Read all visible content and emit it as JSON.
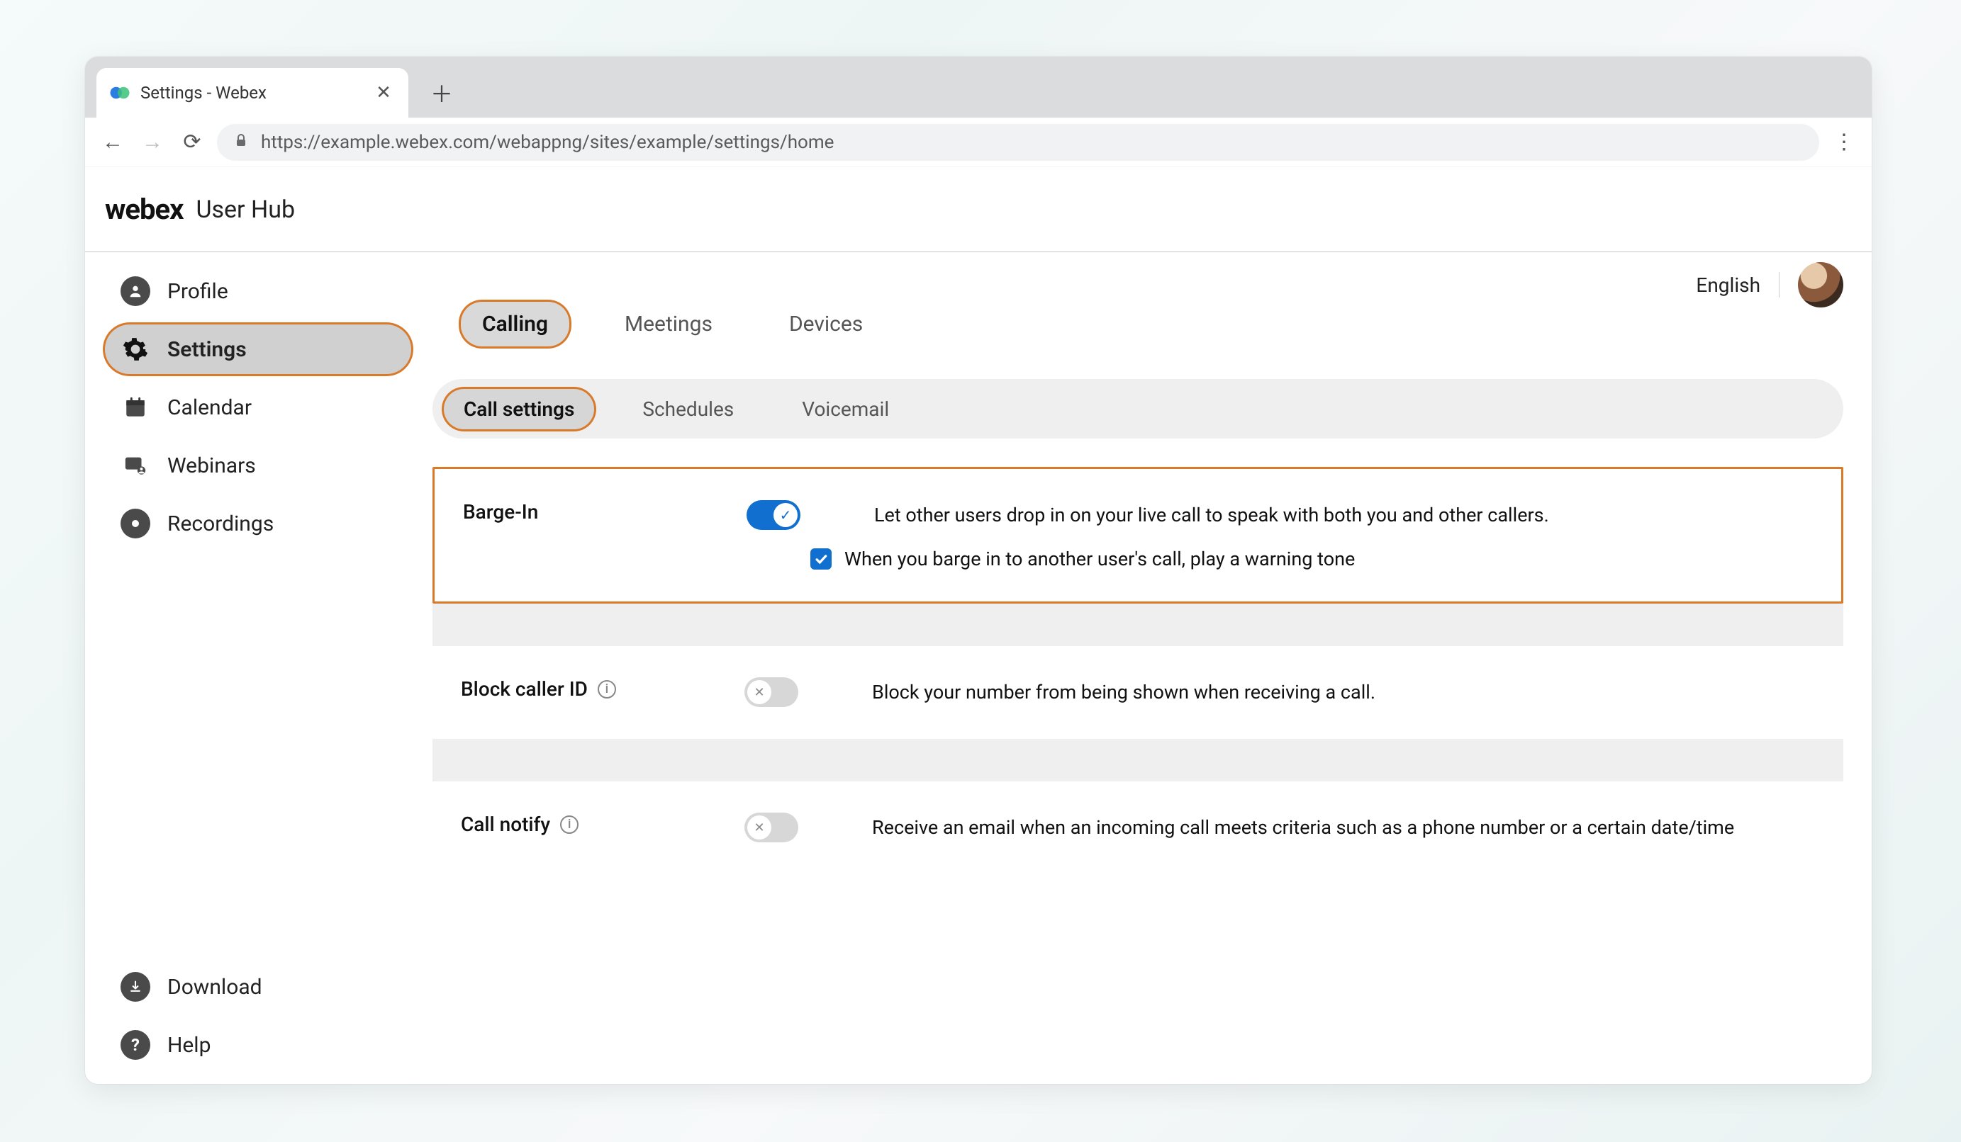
{
  "browser": {
    "tab_title": "Settings - Webex",
    "url": "https://example.webex.com/webappng/sites/example/settings/home"
  },
  "header": {
    "brand": "webex",
    "subtitle": "User Hub"
  },
  "topright": {
    "language": "English"
  },
  "sidebar": {
    "items": [
      {
        "key": "profile",
        "label": "Profile"
      },
      {
        "key": "settings",
        "label": "Settings"
      },
      {
        "key": "calendar",
        "label": "Calendar"
      },
      {
        "key": "webinars",
        "label": "Webinars"
      },
      {
        "key": "recordings",
        "label": "Recordings"
      }
    ],
    "footer": [
      {
        "key": "download",
        "label": "Download"
      },
      {
        "key": "help",
        "label": "Help"
      }
    ],
    "active": "settings"
  },
  "main_tabs": {
    "items": [
      {
        "key": "calling",
        "label": "Calling"
      },
      {
        "key": "meetings",
        "label": "Meetings"
      },
      {
        "key": "devices",
        "label": "Devices"
      }
    ],
    "active": "calling"
  },
  "sub_tabs": {
    "items": [
      {
        "key": "call-settings",
        "label": "Call settings"
      },
      {
        "key": "schedules",
        "label": "Schedules"
      },
      {
        "key": "voicemail",
        "label": "Voicemail"
      }
    ],
    "active": "call-settings"
  },
  "settings_rows": {
    "barge_in": {
      "title": "Barge-In",
      "enabled": true,
      "description": "Let other users drop in on your live call to speak with both you and other callers.",
      "checkbox_checked": true,
      "checkbox_label": "When you barge in to another user's call, play a warning tone"
    },
    "block_caller_id": {
      "title": "Block caller ID",
      "enabled": false,
      "description": "Block your number from being shown when receiving a call."
    },
    "call_notify": {
      "title": "Call notify",
      "enabled": false,
      "description": "Receive an email when an incoming call meets criteria such as a phone number or a certain date/time"
    }
  },
  "colors": {
    "highlight": "#d97a2b",
    "toggle_on": "#1170cf"
  }
}
